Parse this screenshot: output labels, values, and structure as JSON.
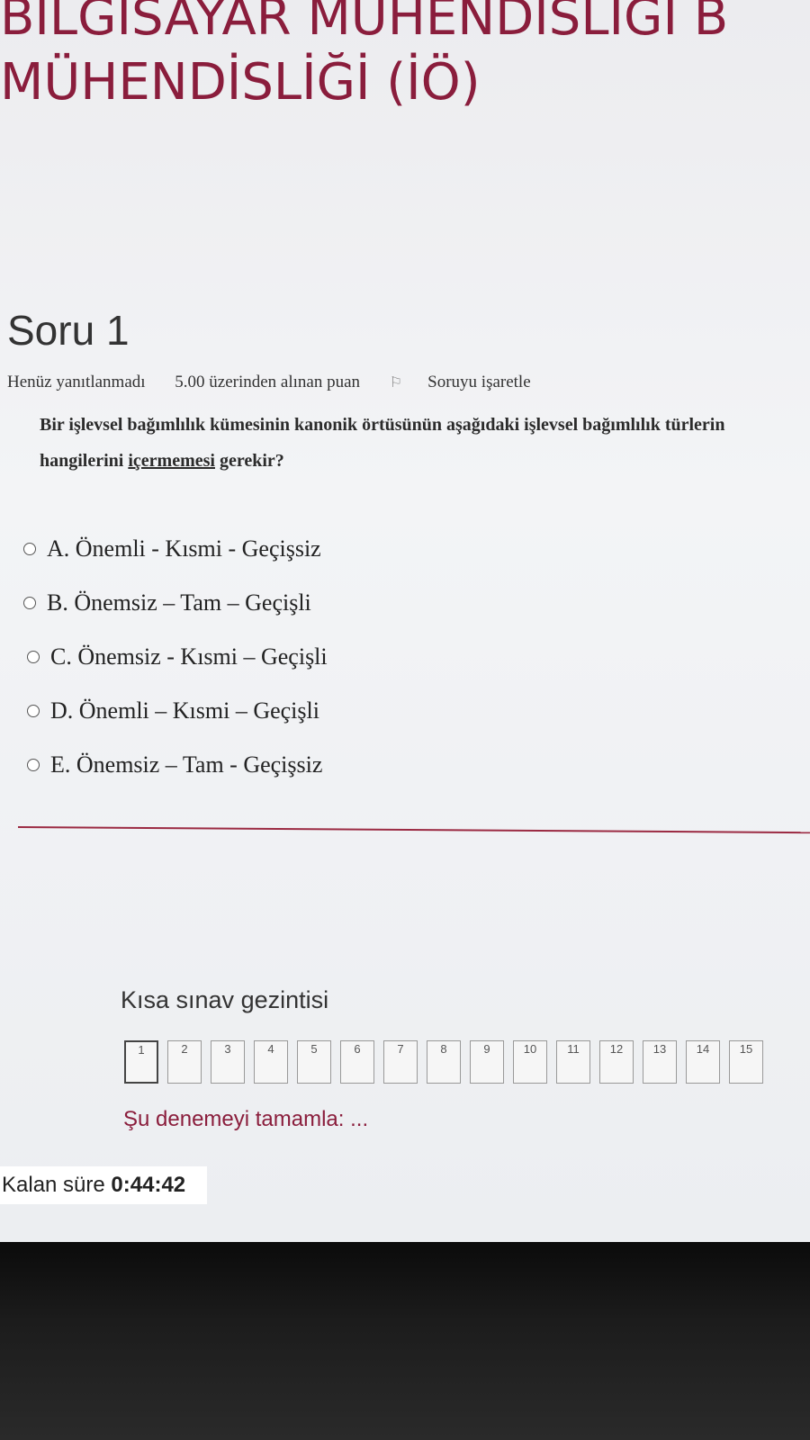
{
  "header": {
    "course_title_line1": "BİLGİSAYAR MÜHENDİSLİĞİ B",
    "course_title_line2": "MÜHENDİSLİĞİ (İÖ)"
  },
  "question": {
    "heading": "Soru 1",
    "status": "Henüz yanıtlanmadı",
    "points": "5.00 üzerinden alınan puan",
    "flag_label": "Soruyu işaretle",
    "text_line1": "Bir işlevsel bağımlılık kümesinin kanonik örtüsünün aşağıdaki işlevsel bağımlılık türlerin",
    "text_line2_prefix": "hangilerini ",
    "text_line2_underlined": "içermemesi",
    "text_line2_suffix": " gerekir?",
    "answers": [
      "A. Önemli - Kısmi - Geçişsiz",
      "B. Önemsiz – Tam – Geçişli",
      "C. Önemsiz - Kısmi – Geçişli",
      "D. Önemli – Kısmi – Geçişli",
      "E. Önemsiz – Tam - Geçişsiz"
    ]
  },
  "quiz_nav": {
    "title": "Kısa sınav gezintisi",
    "buttons": [
      "1",
      "2",
      "3",
      "4",
      "5",
      "6",
      "7",
      "8",
      "9",
      "10",
      "11",
      "12",
      "13",
      "14",
      "15"
    ],
    "current": "1",
    "finish_link": "Şu denemeyi tamamla: ..."
  },
  "timer": {
    "label": "Kalan süre",
    "value": "0:44:42"
  },
  "colors": {
    "accent": "#8a1d3c"
  }
}
